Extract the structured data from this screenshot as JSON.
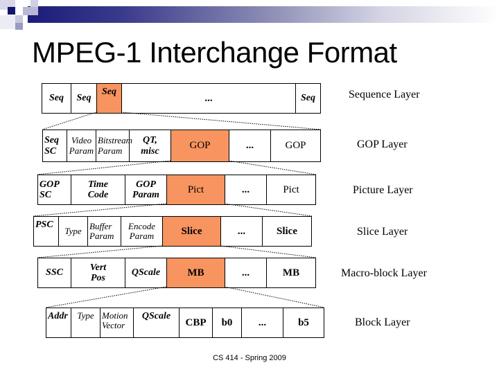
{
  "slide": {
    "title": "MPEG-1 Interchange Format",
    "footer": "CS 414 - Spring 2009"
  },
  "colors": {
    "highlight": "#f79460",
    "banner_dark": "#1c1c7a"
  },
  "layers": [
    {
      "label": "Sequence Layer",
      "cells": [
        {
          "text": "Seq",
          "style": "bold-italic"
        },
        {
          "text": "Seq",
          "style": "bold-italic"
        },
        {
          "text": "Seq",
          "style": "bold-italic",
          "highlight": true
        },
        {
          "text": "...",
          "style": "bold"
        },
        {
          "text": "Seq",
          "style": "bold-italic"
        }
      ]
    },
    {
      "label": "GOP Layer",
      "cells": [
        {
          "text": "Seq\nSC",
          "style": "bold-italic"
        },
        {
          "text": "Video\nParam",
          "style": "italic"
        },
        {
          "text": "Bitstream\nParam",
          "style": "italic"
        },
        {
          "text": "QT,\nmisc",
          "style": "bold-italic"
        },
        {
          "text": "GOP",
          "style": "regular",
          "highlight": true
        },
        {
          "text": "...",
          "style": "bold"
        },
        {
          "text": "GOP",
          "style": "regular"
        }
      ]
    },
    {
      "label": "Picture Layer",
      "cells": [
        {
          "text": "GOP\nSC",
          "style": "bold-italic"
        },
        {
          "text": "Time\nCode",
          "style": "bold-italic"
        },
        {
          "text": "GOP\nParam",
          "style": "bold-italic"
        },
        {
          "text": "Pict",
          "style": "regular",
          "highlight": true
        },
        {
          "text": "...",
          "style": "bold"
        },
        {
          "text": "Pict",
          "style": "regular"
        }
      ]
    },
    {
      "label": "Slice Layer",
      "cells": [
        {
          "text": "PSC",
          "style": "bold-italic"
        },
        {
          "text": "Type",
          "style": "italic"
        },
        {
          "text": "Buffer\nParam",
          "style": "italic"
        },
        {
          "text": "Encode\nParam",
          "style": "italic"
        },
        {
          "text": "Slice",
          "style": "bold",
          "highlight": true
        },
        {
          "text": "...",
          "style": "bold"
        },
        {
          "text": "Slice",
          "style": "bold"
        }
      ]
    },
    {
      "label": "Macro-block Layer",
      "cells": [
        {
          "text": "SSC",
          "style": "bold-italic"
        },
        {
          "text": "Vert\nPos",
          "style": "bold-italic"
        },
        {
          "text": "QScale",
          "style": "bold-italic"
        },
        {
          "text": "MB",
          "style": "bold",
          "highlight": true
        },
        {
          "text": "...",
          "style": "bold"
        },
        {
          "text": "MB",
          "style": "bold"
        }
      ]
    },
    {
      "label": "Block Layer",
      "cells": [
        {
          "text": "Addr",
          "style": "bold-italic"
        },
        {
          "text": "Type",
          "style": "italic"
        },
        {
          "text": "Motion\nVector",
          "style": "italic"
        },
        {
          "text": "QScale",
          "style": "bold-italic"
        },
        {
          "text": "CBP",
          "style": "bold"
        },
        {
          "text": "b0",
          "style": "bold"
        },
        {
          "text": "...",
          "style": "bold"
        },
        {
          "text": "b5",
          "style": "bold"
        }
      ]
    }
  ]
}
